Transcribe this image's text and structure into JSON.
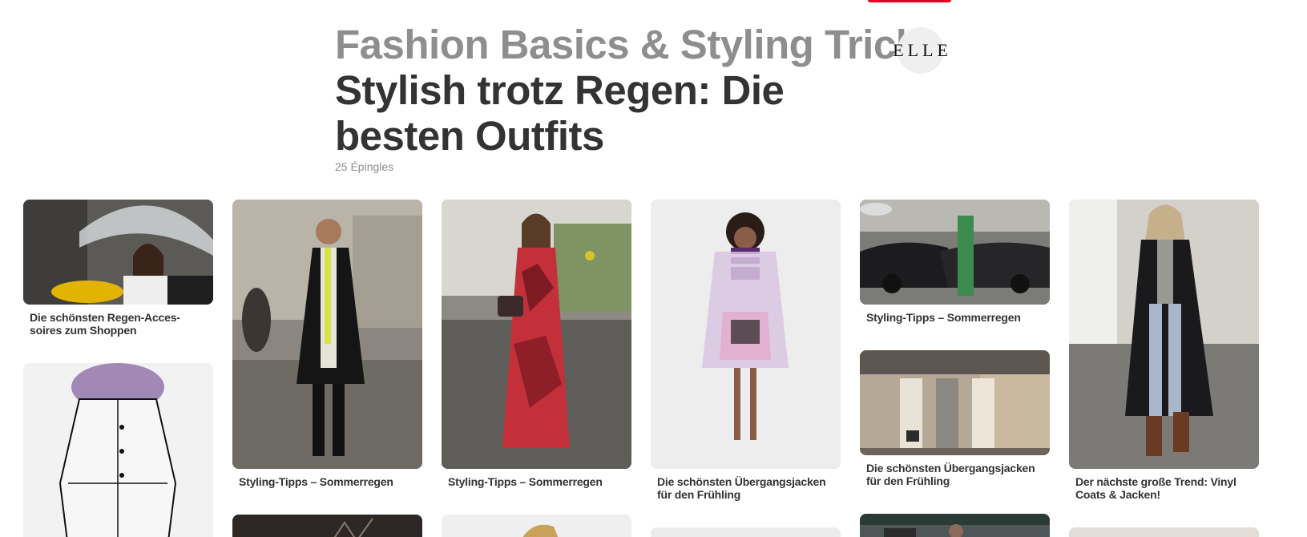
{
  "header": {
    "section_title": "Fashion Basics & Styling Tricks",
    "board_title": "Stylish trotz Regen: Die besten Outfits",
    "pin_count": "25 Épingles",
    "brand_logo_text": "ELLE"
  },
  "colors": {
    "accent": "#e60023",
    "muted_text": "#8e8e8e",
    "body_text": "#333333"
  },
  "pins": [
    {
      "caption": "Die schönsten Regen-Acces-soires zum Shoppen"
    },
    {
      "caption": ""
    },
    {
      "caption": "Styling-Tipps – Sommerregen"
    },
    {
      "caption": "Styling-Tipps – Sommerregen"
    },
    {
      "caption": "Die schönsten Übergangsjacken für den Frühling"
    },
    {
      "caption": "Styling-Tipps – Sommerregen"
    },
    {
      "caption": "Die schönsten Übergangsjacken für den Frühling"
    },
    {
      "caption": "Der nächste große Trend: Vinyl Coats & Jacken!"
    }
  ]
}
